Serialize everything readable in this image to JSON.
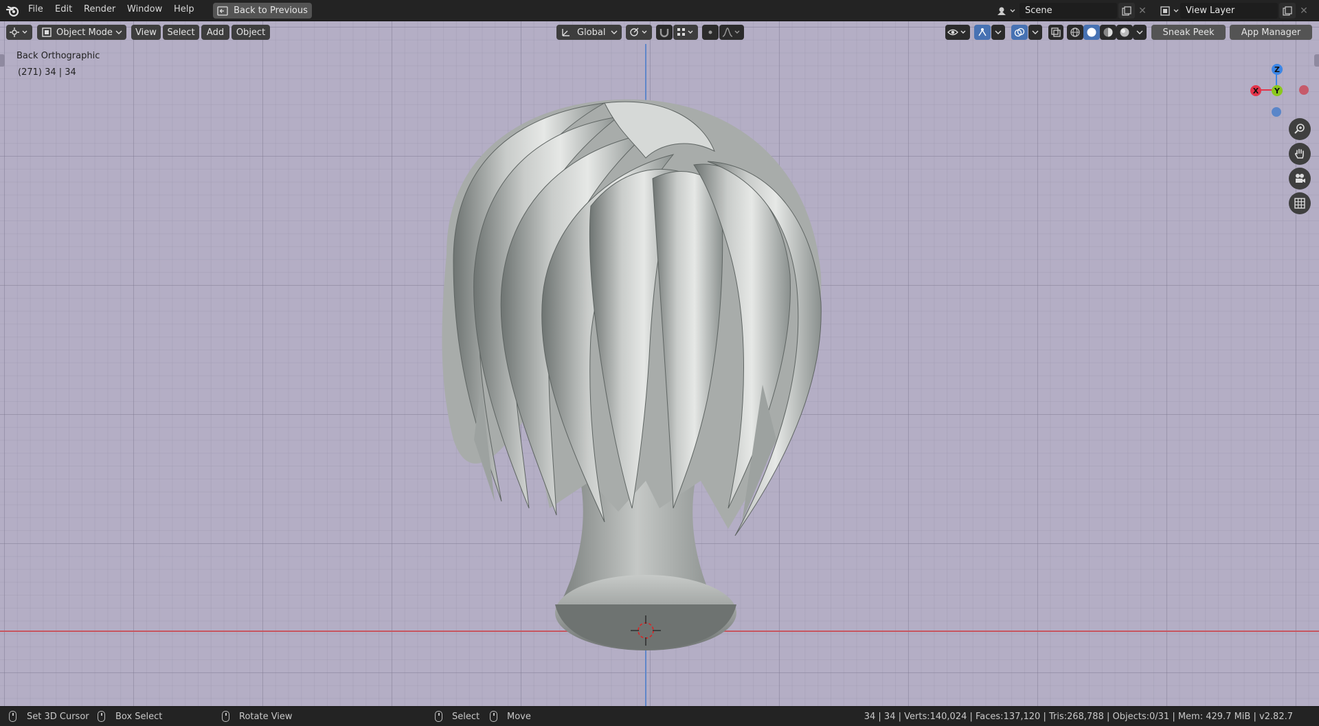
{
  "menu": {
    "items": [
      "File",
      "Edit",
      "Render",
      "Window",
      "Help"
    ],
    "back_button": "Back to Previous"
  },
  "topright": {
    "scene": "Scene",
    "view_layer": "View Layer"
  },
  "header": {
    "mode": "Object Mode",
    "view": "View",
    "select": "Select",
    "add": "Add",
    "object": "Object",
    "orientation": "Global",
    "sneak_peek": "Sneak Peek",
    "app_manager": "App Manager"
  },
  "viewport": {
    "view_name": "Back Orthographic",
    "frame_info": "(271) 34 | 34",
    "gizmo": {
      "z": "Z",
      "y": "Y",
      "x": "X"
    },
    "colors": {
      "x_axis": "#e3344a",
      "y_axis": "#8bc81d",
      "z_axis": "#3c86e6",
      "background": "#b4aec5"
    }
  },
  "status": {
    "set_cursor": "Set 3D Cursor",
    "box_select": "Box Select",
    "rotate_view": "Rotate View",
    "select": "Select",
    "move": "Move",
    "stats": "34 | 34 | Verts:140,024 | Faces:137,120 | Tris:268,788 | Objects:0/31 | Mem: 429.7 MiB | v2.82.7"
  }
}
